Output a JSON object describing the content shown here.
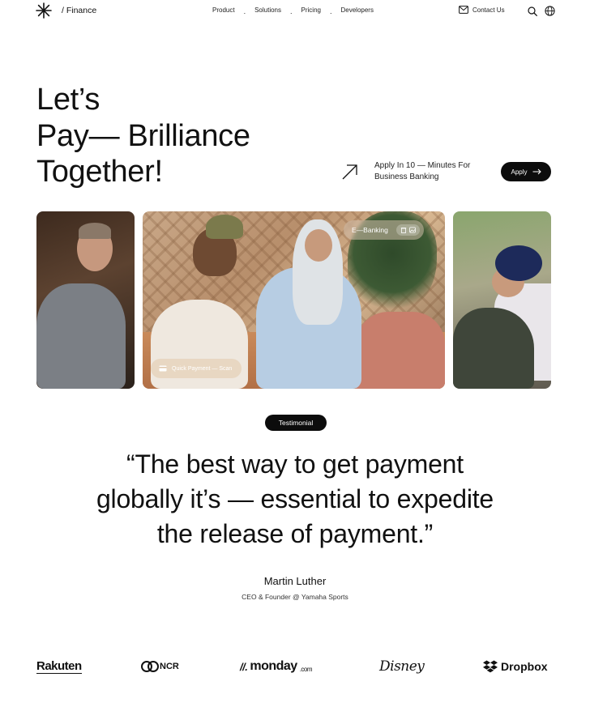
{
  "header": {
    "brand": "/ Finance",
    "logo_icon": "asterisk-icon",
    "nav": [
      "Product",
      "Solutions",
      "Pricing",
      "Developers"
    ],
    "nav_separator": ".",
    "contact_label": "Contact Us",
    "contact_icon": "mail-icon",
    "search_icon": "search-icon",
    "language_icon": "globe-icon"
  },
  "hero": {
    "title_lines": [
      "Let’s",
      "Pay— Brilliance",
      "Together!"
    ],
    "apply_text_line1": "Apply In 10 — Minutes For",
    "apply_text_line2": "Business Banking",
    "apply_button": "Apply",
    "arrow_icon": "arrow-up-right-icon"
  },
  "photo_overlays": {
    "ebanking_label": "E—Banking",
    "ebanking_icons": [
      "trash-icon",
      "image-icon"
    ],
    "quick_payment_label": "Quick Payment — Scan",
    "quick_payment_icon": "card-icon"
  },
  "testimonial": {
    "badge": "Testimonial",
    "quote_line1": "“The best way to get payment",
    "quote_line2": "globally it’s — essential to expedite",
    "quote_line3": "the release of payment.”",
    "author": "Martin Luther",
    "role": "CEO & Founder @ Yamaha Sports"
  },
  "logos": {
    "rakuten": "Rakuten",
    "ncr": "NCR",
    "monday_marks": "//.",
    "monday": "monday",
    "monday_suffix": ".com",
    "disney": "Disney",
    "dropbox": "Dropbox"
  },
  "colors": {
    "text": "#111111",
    "button_bg": "#0c0c0c",
    "button_text": "#ffffff",
    "background": "#ffffff"
  }
}
